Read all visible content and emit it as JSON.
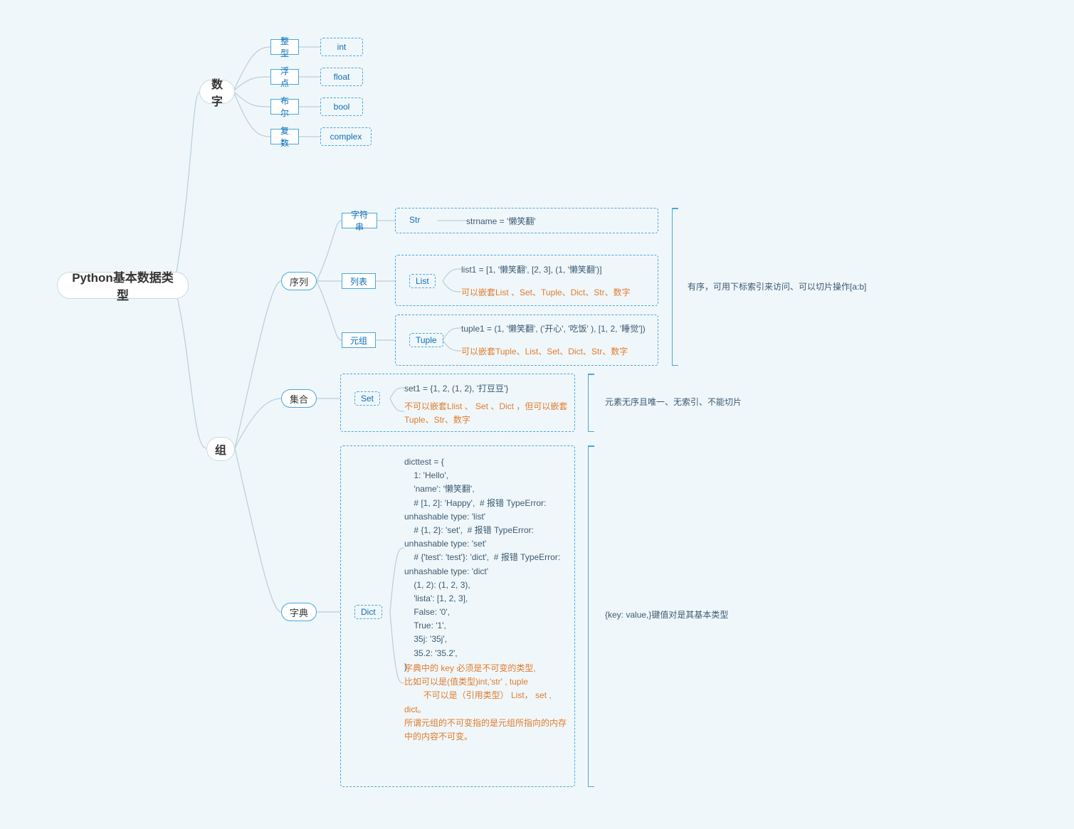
{
  "root": "Python基本数据类型",
  "numbers": {
    "label": "数字",
    "items": [
      {
        "zh": "整型",
        "en": "int"
      },
      {
        "zh": "浮点",
        "en": "float"
      },
      {
        "zh": "布尔",
        "en": "bool"
      },
      {
        "zh": "复数",
        "en": "complex"
      }
    ]
  },
  "group": {
    "label": "组",
    "sequence": {
      "label": "序列",
      "note": "有序，可用下标索引来访问、可以切片操作[a:b]",
      "string": {
        "zh": "字符串",
        "en": "Str",
        "example": "strname = '懒笑翻'"
      },
      "list": {
        "zh": "列表",
        "en": "List",
        "example": "list1 = [1, '懒笑翻',  [2, 3],  (1, '懒笑翻')]",
        "nest": "可以嵌套List 、Set、Tuple、Dict、Str、数字"
      },
      "tuple": {
        "zh": "元组",
        "en": "Tuple",
        "example": "tuple1 = (1, '懒笑翻', ('开心', '吃饭' ), [1, 2, '睡觉'])",
        "nest": "可以嵌套Tuple、List、Set、Dict、Str、数字"
      }
    },
    "set": {
      "label": "集合",
      "en": "Set",
      "example": "set1 = {1, 2, (1, 2), '打豆豆'}",
      "nest": "不可以嵌套Llist 、 Set 、Dict ，但可以嵌套Tuple、Str、数字",
      "note": "元素无序且唯一、无索引、不能切片"
    },
    "dict": {
      "label": "字典",
      "en": "Dict",
      "note": "{key: value,}键值对是其基本类型",
      "code": "dicttest = {\n    1: 'Hello',\n    'name': '懒笑翻',\n    # [1, 2]: 'Happy',  # 报错 TypeError: unhashable type: 'list'\n    # {1, 2}: 'set',  # 报错 TypeError: unhashable type: 'set'\n    # {'test': 'test'}: 'dict',  # 报错 TypeError: unhashable type: 'dict'\n    (1, 2): (1, 2, 3),\n    'lista': [1, 2, 3],\n    False: '0',\n    True: '1',\n    35j: '35j',\n    35.2: '35.2',\n}",
      "desc": "字典中的 key 必须是不可变的类型,\n比如可以是(值类型)int,'str' , tuple\n        不可以是（引用类型） List， set , dict。\n所谓元组的不可变指的是元组所指向的内存中的内容不可变。"
    }
  }
}
